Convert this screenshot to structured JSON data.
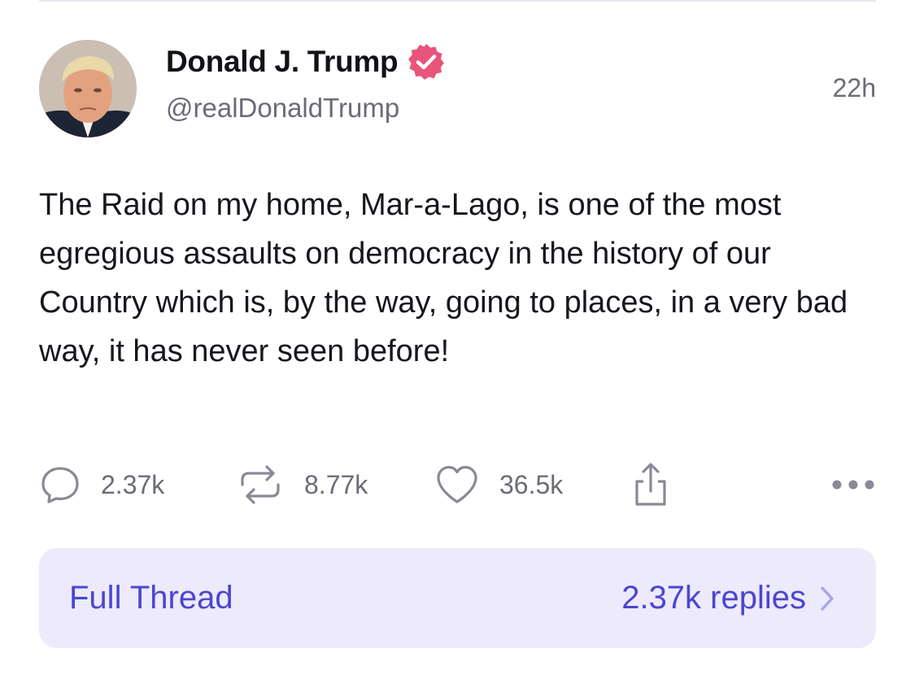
{
  "post": {
    "author": {
      "display_name": "Donald J. Trump",
      "handle": "@realDonaldTrump",
      "verified": true,
      "avatar_icon": "profile-photo"
    },
    "timestamp": "22h",
    "text": "The Raid on my home, Mar-a-Lago, is one of the most egregious assaults on democracy in the history of our Country which is, by the way, going to places, in a very bad way, it has never seen before!",
    "actions": {
      "replies": {
        "icon": "comment-bubble-icon",
        "count": "2.37k"
      },
      "reposts": {
        "icon": "repost-arrows-icon",
        "count": "8.77k"
      },
      "likes": {
        "icon": "heart-icon",
        "count": "36.5k"
      },
      "share": {
        "icon": "share-icon"
      },
      "more": {
        "icon": "more-dots-icon"
      }
    }
  },
  "thread": {
    "label": "Full Thread",
    "replies_label": "2.37k replies"
  },
  "colors": {
    "verified_badge": "#e9557a",
    "accent": "#4a47d0",
    "thread_bg": "#edeafc",
    "muted": "#6b6b78",
    "icon": "#8a8a96"
  }
}
